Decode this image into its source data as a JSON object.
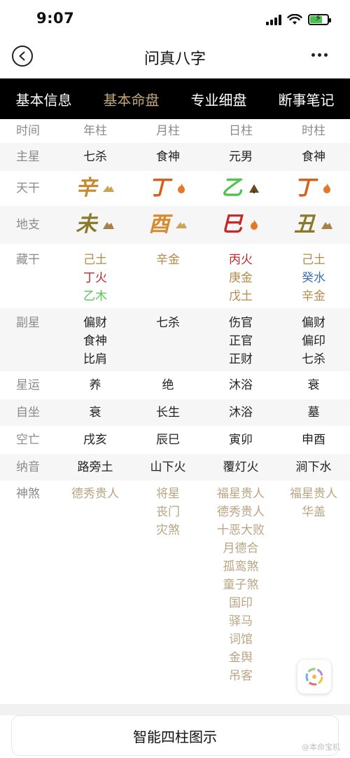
{
  "status": {
    "time": "9:07"
  },
  "nav": {
    "title": "问真八字"
  },
  "tabs": [
    {
      "label": "基本信息",
      "active": false
    },
    {
      "label": "基本命盘",
      "active": true
    },
    {
      "label": "专业细盘",
      "active": false
    },
    {
      "label": "断事笔记",
      "active": false
    }
  ],
  "header": {
    "row_label": "时间",
    "cols": [
      "年柱",
      "月柱",
      "日柱",
      "时柱"
    ]
  },
  "zhuxing": {
    "label": "主星",
    "values": [
      "七杀",
      "食神",
      "元男",
      "食神"
    ]
  },
  "tiangan": {
    "label": "天干",
    "values": [
      "辛",
      "丁",
      "乙",
      "丁"
    ],
    "colors": [
      "#c88a2c",
      "#d95e1c",
      "#52c24e",
      "#d95e1c"
    ],
    "icons": [
      "metal-icon",
      "fire-icon",
      "wood-icon",
      "fire-icon"
    ]
  },
  "dizhi": {
    "label": "地支",
    "values": [
      "未",
      "酉",
      "巳",
      "丑"
    ],
    "colors": [
      "#897a29",
      "#d58b2d",
      "#c3292b",
      "#897a29"
    ],
    "icons": [
      "earth-icon",
      "metal-icon",
      "fire-icon",
      "earth-icon"
    ]
  },
  "canggan": {
    "label": "藏干",
    "cols": [
      [
        "己土",
        "丁火",
        "乙木"
      ],
      [
        "辛金"
      ],
      [
        "丙火",
        "庚金",
        "戊土"
      ],
      [
        "己土",
        "癸水",
        "辛金"
      ]
    ]
  },
  "fuxing": {
    "label": "副星",
    "cols": [
      [
        "偏财",
        "食神",
        "比肩"
      ],
      [
        "七杀"
      ],
      [
        "伤官",
        "正官",
        "正财"
      ],
      [
        "偏财",
        "偏印",
        "七杀"
      ]
    ]
  },
  "xingyun": {
    "label": "星运",
    "values": [
      "养",
      "绝",
      "沐浴",
      "衰"
    ]
  },
  "zizuo": {
    "label": "自坐",
    "values": [
      "衰",
      "长生",
      "沐浴",
      "墓"
    ]
  },
  "kongwang": {
    "label": "空亡",
    "values": [
      "戌亥",
      "辰巳",
      "寅卯",
      "申酉"
    ]
  },
  "nayin": {
    "label": "纳音",
    "values": [
      "路旁土",
      "山下火",
      "覆灯火",
      "涧下水"
    ]
  },
  "shensha": {
    "label": "神煞",
    "cols": [
      [
        "德秀贵人"
      ],
      [
        "将星",
        "丧门",
        "灾煞"
      ],
      [
        "福星贵人",
        "德秀贵人",
        "十恶大败",
        "月德合",
        "孤鸾煞",
        "童子煞",
        "国印",
        "驿马",
        "词馆",
        "金舆",
        "吊客"
      ],
      [
        "福星贵人",
        "华盖"
      ]
    ]
  },
  "bottom_button": "智能四柱图示",
  "watermark": "@本命宝机"
}
